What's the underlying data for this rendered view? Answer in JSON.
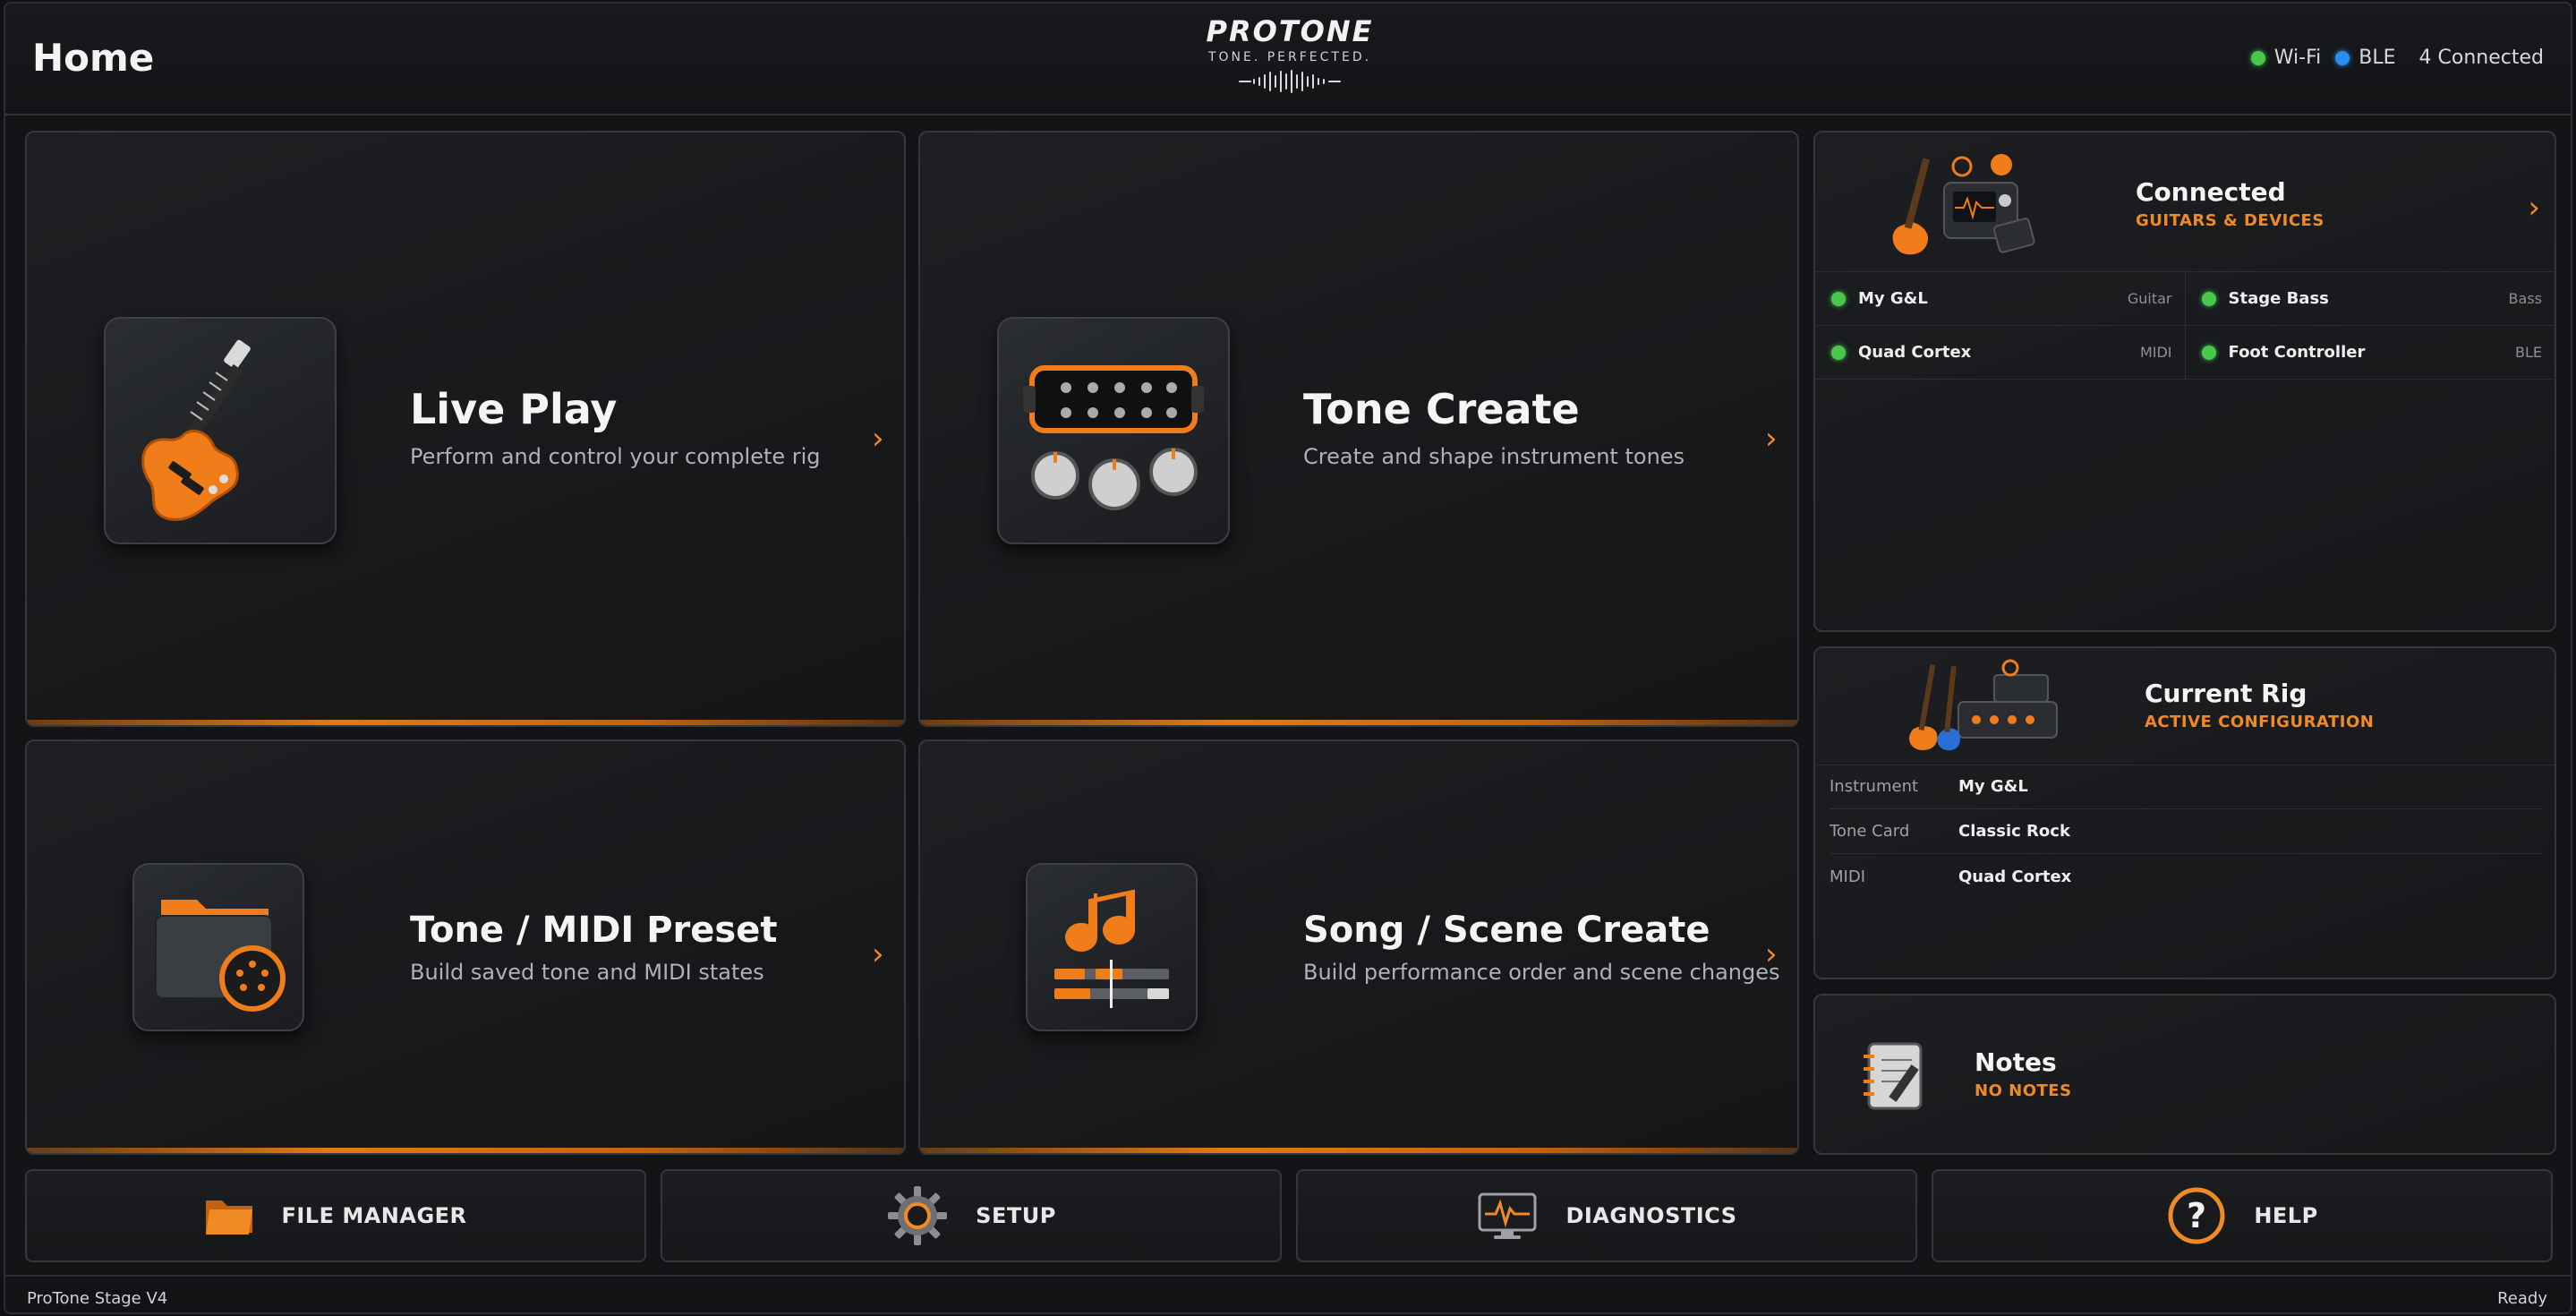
{
  "header": {
    "title": "Home",
    "logo": {
      "brand": "PROTONE",
      "tagline": "TONE. PERFECTED."
    },
    "status": {
      "wifi": "Wi-Fi",
      "ble": "BLE",
      "connected": "4 Connected"
    }
  },
  "tiles": [
    {
      "title": "Live Play",
      "subtitle": "Perform and control your complete rig",
      "icon": "electric-guitar-icon"
    },
    {
      "title": "Tone Create",
      "subtitle": "Create and shape instrument tones",
      "icon": "pickup-knobs-icon"
    },
    {
      "title": "Tone / MIDI Preset",
      "subtitle": "Build saved tone and MIDI states",
      "icon": "folder-midi-icon"
    },
    {
      "title": "Song / Scene Create",
      "subtitle": "Build performance order and scene changes",
      "icon": "music-note-icon"
    }
  ],
  "connected": {
    "title": "Connected",
    "subtitle": "GUITARS & DEVICES",
    "devices": [
      {
        "name": "My G&L",
        "type": "Guitar"
      },
      {
        "name": "Stage Bass",
        "type": "Bass"
      },
      {
        "name": "Quad Cortex",
        "type": "MIDI"
      },
      {
        "name": "Foot Controller",
        "type": "BLE"
      }
    ]
  },
  "current_rig": {
    "title": "Current Rig",
    "subtitle": "ACTIVE CONFIGURATION",
    "rows": [
      {
        "key": "Instrument",
        "value": "My G&L"
      },
      {
        "key": "Tone Card",
        "value": "Classic Rock"
      },
      {
        "key": "MIDI",
        "value": "Quad Cortex"
      }
    ]
  },
  "notes": {
    "title": "Notes",
    "subtitle": "NO NOTES"
  },
  "bottom_bar": [
    {
      "label": "FILE MANAGER",
      "icon": "folder-icon"
    },
    {
      "label": "SETUP",
      "icon": "gear-icon"
    },
    {
      "label": "DIAGNOSTICS",
      "icon": "monitor-pulse-icon"
    },
    {
      "label": "HELP",
      "icon": "help-icon"
    }
  ],
  "footer": {
    "app": "ProTone Stage V4",
    "state": "Ready"
  },
  "colors": {
    "accent": "#f08a24",
    "wifi": "#49c94b",
    "ble": "#2a8ef0",
    "background": "#121416"
  }
}
